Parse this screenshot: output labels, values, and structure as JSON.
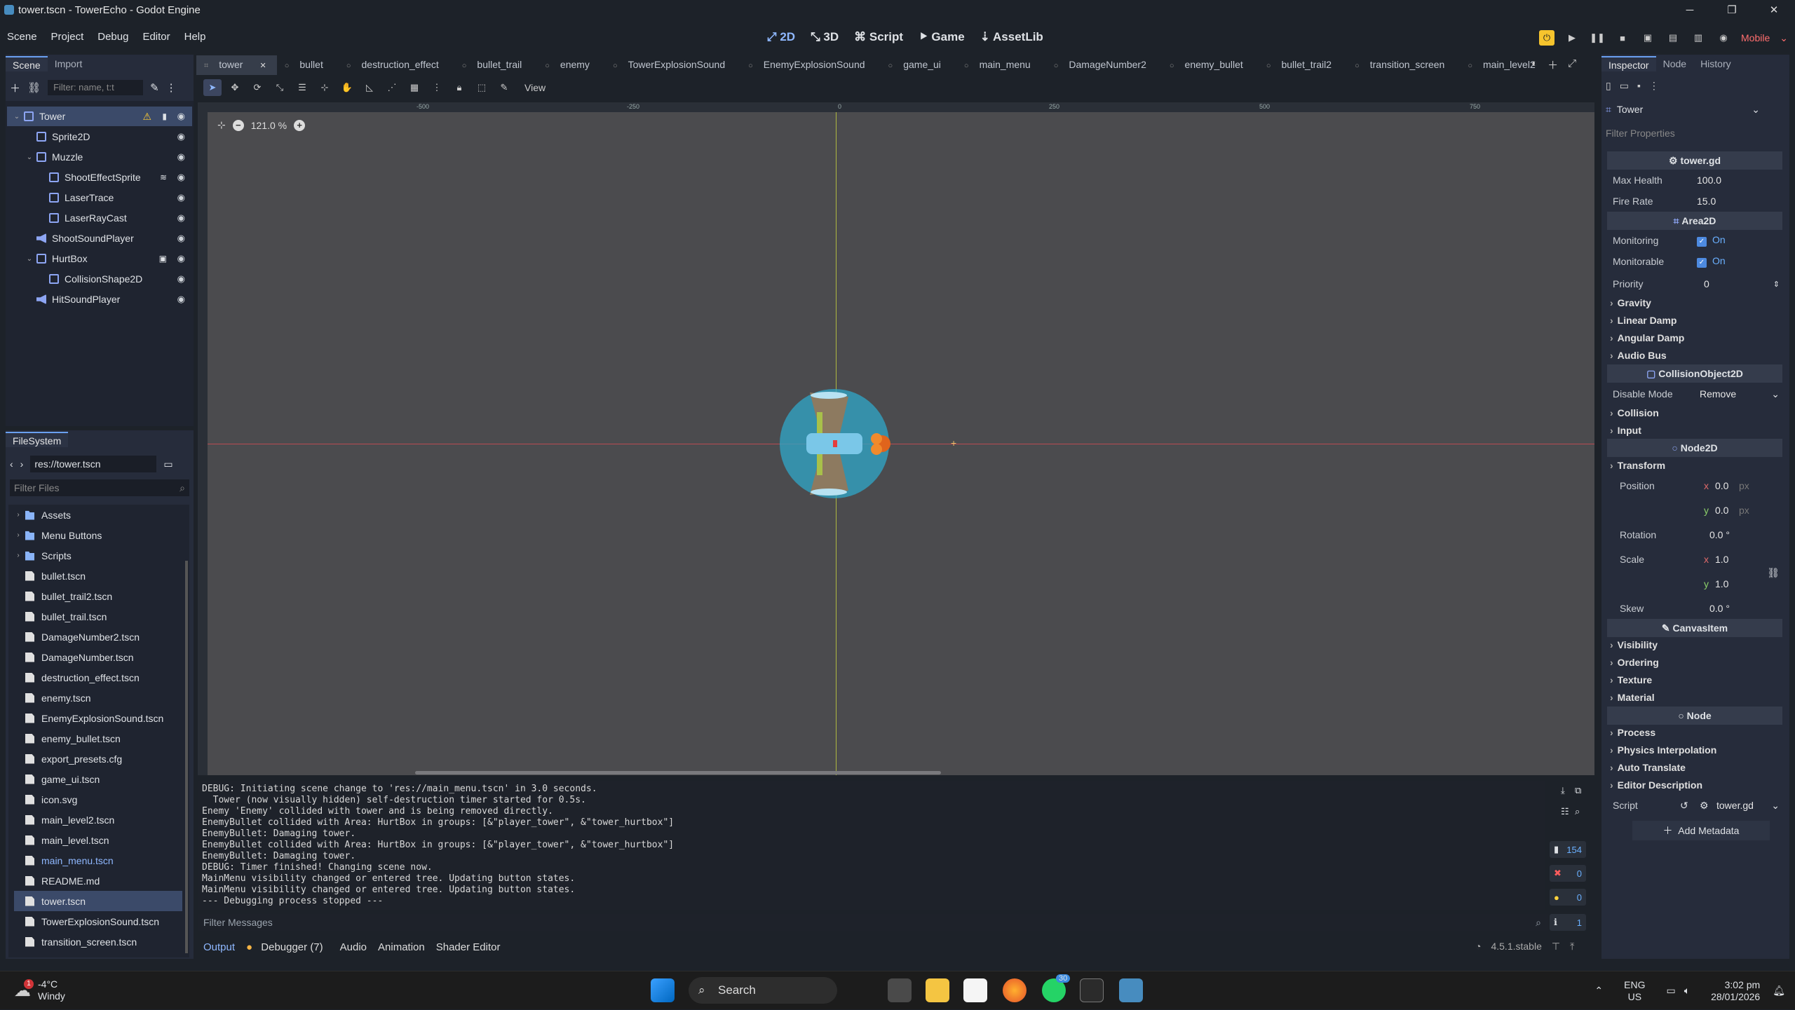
{
  "window": {
    "title": "tower.tscn - TowerEcho - Godot Engine",
    "controls": [
      "─",
      "❐",
      "✕"
    ]
  },
  "menu": [
    "Scene",
    "Project",
    "Debug",
    "Editor",
    "Help"
  ],
  "main_screens": [
    {
      "icon": "⤢",
      "label": "2D"
    },
    {
      "icon": "⤡",
      "label": "3D"
    },
    {
      "icon": "⌘",
      "label": "Script"
    },
    {
      "icon": "⯈",
      "label": "Game"
    },
    {
      "icon": "⇣",
      "label": "AssetLib"
    }
  ],
  "renderer": "Mobile",
  "scene_dock": {
    "tabs": [
      "Scene",
      "Import"
    ],
    "filter_placeholder": "Filter: name, t:t",
    "nodes": [
      {
        "label": "Tower",
        "depth": 0,
        "icon": "node2d",
        "selected": true,
        "warning": true
      },
      {
        "label": "Sprite2D",
        "depth": 1,
        "icon": "sprite"
      },
      {
        "label": "Muzzle",
        "depth": 1,
        "icon": "node2d"
      },
      {
        "label": "ShootEffectSprite",
        "depth": 2,
        "icon": "sprite"
      },
      {
        "label": "LaserTrace",
        "depth": 2,
        "icon": "line"
      },
      {
        "label": "LaserRayCast",
        "depth": 2,
        "icon": "raycast"
      },
      {
        "label": "ShootSoundPlayer",
        "depth": 1,
        "icon": "audio"
      },
      {
        "label": "HurtBox",
        "depth": 1,
        "icon": "area"
      },
      {
        "label": "CollisionShape2D",
        "depth": 2,
        "icon": "shape"
      },
      {
        "label": "HitSoundPlayer",
        "depth": 1,
        "icon": "audio"
      }
    ]
  },
  "filesystem": {
    "tab": "FileSystem",
    "path": "res://tower.tscn",
    "filter_placeholder": "Filter Files",
    "items": [
      {
        "label": "Assets",
        "type": "folder"
      },
      {
        "label": "Menu Buttons",
        "type": "folder"
      },
      {
        "label": "Scripts",
        "type": "folder"
      },
      {
        "label": "bullet.tscn",
        "type": "file"
      },
      {
        "label": "bullet_trail2.tscn",
        "type": "file"
      },
      {
        "label": "bullet_trail.tscn",
        "type": "file"
      },
      {
        "label": "DamageNumber2.tscn",
        "type": "file"
      },
      {
        "label": "DamageNumber.tscn",
        "type": "file"
      },
      {
        "label": "destruction_effect.tscn",
        "type": "file"
      },
      {
        "label": "enemy.tscn",
        "type": "file"
      },
      {
        "label": "EnemyExplosionSound.tscn",
        "type": "file"
      },
      {
        "label": "enemy_bullet.tscn",
        "type": "file"
      },
      {
        "label": "export_presets.cfg",
        "type": "file"
      },
      {
        "label": "game_ui.tscn",
        "type": "file"
      },
      {
        "label": "icon.svg",
        "type": "file"
      },
      {
        "label": "main_level2.tscn",
        "type": "file"
      },
      {
        "label": "main_level.tscn",
        "type": "file"
      },
      {
        "label": "main_menu.tscn",
        "type": "file",
        "accent": true
      },
      {
        "label": "README.md",
        "type": "file"
      },
      {
        "label": "tower.tscn",
        "type": "file",
        "selected": true
      },
      {
        "label": "TowerExplosionSound.tscn",
        "type": "file"
      },
      {
        "label": "transition_screen.tscn",
        "type": "file"
      }
    ]
  },
  "editor_tabs": [
    "tower",
    "bullet",
    "destruction_effect",
    "bullet_trail",
    "enemy",
    "TowerExplosionSound",
    "EnemyExplosionSound",
    "game_ui",
    "main_menu",
    "DamageNumber2",
    "enemy_bullet",
    "bullet_trail2",
    "transition_screen",
    "main_level2"
  ],
  "toolbar": {
    "view_label": "View"
  },
  "viewport": {
    "zoom": "121.0 %",
    "ruler_ticks": [
      "-500",
      "-250",
      "0",
      "250",
      "500",
      "750"
    ]
  },
  "output": {
    "lines": [
      "DEBUG: Initiating scene change to 'res://main_menu.tscn' in 3.0 seconds.",
      "  Tower (now visually hidden) self-destruction timer started for 0.5s.",
      "Enemy 'Enemy' collided with tower and is being removed directly.",
      "EnemyBullet collided with Area: HurtBox in groups: [&\"player_tower\", &\"tower_hurtbox\"]",
      "EnemyBullet: Damaging tower.",
      "EnemyBullet collided with Area: HurtBox in groups: [&\"player_tower\", &\"tower_hurtbox\"]",
      "EnemyBullet: Damaging tower.",
      "DEBUG: Timer finished! Changing scene now.",
      "MainMenu visibility changed or entered tree. Updating button states.",
      "MainMenu visibility changed or entered tree. Updating button states.",
      "--- Debugging process stopped ---"
    ],
    "counts": {
      "messages": "154",
      "errors": "0",
      "warnings": "0",
      "info": "1"
    },
    "filter_placeholder": "Filter Messages"
  },
  "bottom_tabs": [
    "Output",
    "Debugger (7)",
    "Audio",
    "Animation",
    "Shader Editor"
  ],
  "version": "4.5.1.stable",
  "inspector": {
    "tabs": [
      "Inspector",
      "Node",
      "History"
    ],
    "node": "Tower",
    "filter_placeholder": "Filter Properties",
    "script_header": "tower.gd",
    "max_health_label": "Max Health",
    "max_health": "100.0",
    "fire_rate_label": "Fire Rate",
    "fire_rate": "15.0",
    "area2d_header": "Area2D",
    "monitoring_label": "Monitoring",
    "monitorable_label": "Monitorable",
    "on_label": "On",
    "priority_label": "Priority",
    "priority": "0",
    "area_sections": [
      "Gravity",
      "Linear Damp",
      "Angular Damp",
      "Audio Bus"
    ],
    "collision_header": "CollisionObject2D",
    "disable_mode_label": "Disable Mode",
    "disable_mode": "Remove",
    "collision_sections": [
      "Collision",
      "Input"
    ],
    "node2d_header": "Node2D",
    "transform_label": "Transform",
    "position_label": "Position",
    "pos_x": "0.0",
    "pos_y": "0.0",
    "px": "px",
    "rotation_label": "Rotation",
    "rotation": "0.0 °",
    "scale_label": "Scale",
    "scale_x": "1.0",
    "scale_y": "1.0",
    "skew_label": "Skew",
    "skew": "0.0 °",
    "canvas_header": "CanvasItem",
    "canvas_sections": [
      "Visibility",
      "Ordering",
      "Texture",
      "Material"
    ],
    "node_header": "Node",
    "node_sections": [
      "Process",
      "Physics Interpolation",
      "Auto Translate",
      "Editor Description"
    ],
    "script_label": "Script",
    "script_value": "tower.gd",
    "add_metadata": "Add Metadata"
  },
  "taskbar": {
    "weather_temp": "-4°C",
    "weather_desc": "Windy",
    "search": "Search",
    "lang1": "ENG",
    "lang2": "US",
    "time": "3:02 pm",
    "date": "28/01/2026",
    "whatsapp_badge": "30",
    "weather_badge": "1"
  }
}
